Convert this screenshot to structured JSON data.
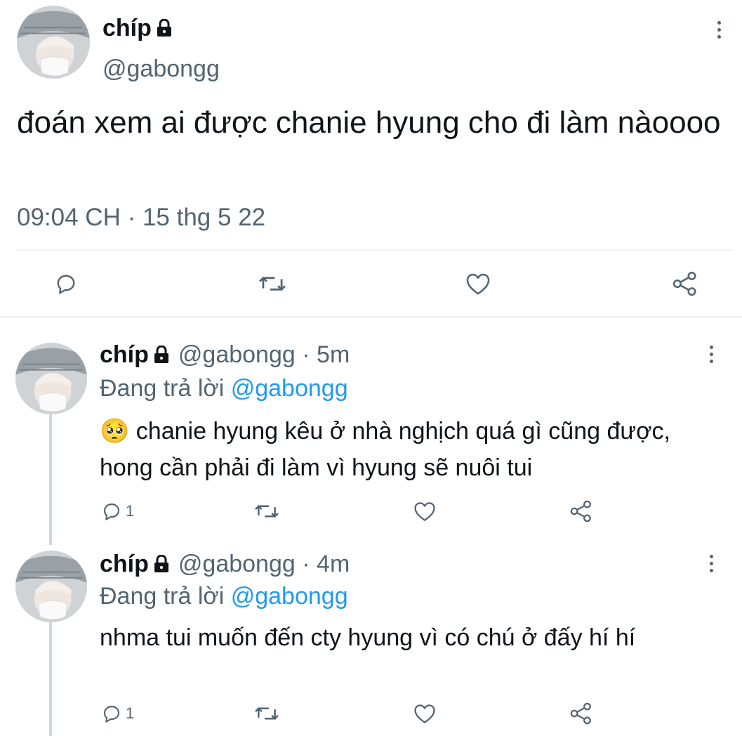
{
  "main_tweet": {
    "display_name": "chíp",
    "handle": "@gabongg",
    "text": "đoán xem ai được chanie hyung cho đi làm nàoooo",
    "timestamp": "09:04 CH · 15 thg 5 22",
    "actions": [
      "reply",
      "retweet",
      "like",
      "share"
    ]
  },
  "replies": [
    {
      "display_name": "chíp",
      "handle": "@gabongg",
      "separator": "·",
      "time": "5m",
      "replying_prefix": "Đang trả lời",
      "replying_to": "@gabongg",
      "emoji": "🥺",
      "text": "chanie hyung kêu ở nhà nghịch quá gì cũng được, hong cần phải đi làm vì hyung sẽ nuôi tui",
      "reply_count": "1"
    },
    {
      "display_name": "chíp",
      "handle": "@gabongg",
      "separator": "·",
      "time": "4m",
      "replying_prefix": "Đang trả lời",
      "replying_to": "@gabongg",
      "text": "nhma tui muốn đến cty hyung vì có chú ở đấy hí hí",
      "reply_count": "1"
    }
  ],
  "colors": {
    "text": "#0f1419",
    "secondary": "#536471",
    "accent": "#1d9bf0",
    "divider": "#eff3f4",
    "thread_line": "#cfd9de"
  }
}
